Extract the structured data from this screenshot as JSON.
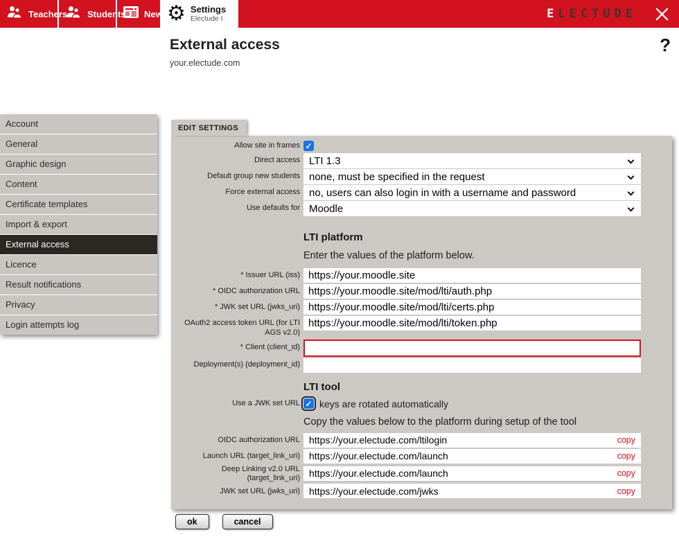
{
  "topbar": {
    "tabs": [
      {
        "label": "Teachers"
      },
      {
        "label": "Students"
      },
      {
        "label": "News"
      },
      {
        "label": "Settings",
        "sublabel": "Electude I"
      }
    ],
    "brand_first_letter": "E",
    "brand_rest": "LECTUDE"
  },
  "header": {
    "title": "External access",
    "subtitle": "your.electude.com",
    "help_label": "?"
  },
  "sidebar": {
    "items": [
      {
        "label": "Account"
      },
      {
        "label": "General"
      },
      {
        "label": "Graphic design"
      },
      {
        "label": "Content"
      },
      {
        "label": "Certificate templates"
      },
      {
        "label": "Import & export"
      },
      {
        "label": "External access",
        "selected": true
      },
      {
        "label": "Licence"
      },
      {
        "label": "Result notifications"
      },
      {
        "label": "Privacy"
      },
      {
        "label": "Login attempts log"
      }
    ]
  },
  "panel": {
    "tab_label": "EDIT SETTINGS",
    "fields": {
      "allow_frames": {
        "label": "Allow site in frames",
        "checked": true
      },
      "direct_access": {
        "label": "Direct access",
        "value": "LTI 1.3"
      },
      "default_group": {
        "label": "Default group new students",
        "value": "none, must be specified in the request"
      },
      "force_external": {
        "label": "Force external access",
        "value": "no, users can also login in with a username and password"
      },
      "use_defaults": {
        "label": "Use defaults for",
        "value": "Moodle"
      }
    },
    "lti_platform": {
      "heading": "LTI platform",
      "intro": "Enter the values of the platform below.",
      "issuer": {
        "label": "* Issuer URL (iss)",
        "value": "https://your.moodle.site"
      },
      "oidc_auth": {
        "label": "* OIDC authorization URL",
        "value": "https://your.moodle.site/mod/lti/auth.php"
      },
      "jwk_set": {
        "label": "* JWK set URL (jwks_uri)",
        "value": "https://your.moodle.site/mod/lti/certs.php"
      },
      "oauth2_token": {
        "label": "OAuth2 access token URL (for LTI AGS v2.0)",
        "value": "https://your.moodle.site/mod/lti/token.php"
      },
      "client": {
        "label": "* Client (client_id)",
        "value": ""
      },
      "deployment": {
        "label": "Deployment(s) (deployment_id)",
        "value": ""
      }
    },
    "lti_tool": {
      "heading": "LTI tool",
      "jwk_checkbox": {
        "label": "Use a JWK set URL",
        "note": "keys are rotated automatically",
        "checked": true
      },
      "copy_intro": "Copy the values below to the platform during setup of the tool",
      "copy_rows": [
        {
          "label": "OIDC authorization URL",
          "value": "https://your.electude.com/ltilogin",
          "action": "copy"
        },
        {
          "label": "Launch URL (target_link_uri)",
          "value": "https://your.electude.com/launch",
          "action": "copy"
        },
        {
          "label": "Deep Linking v2.0 URL (target_link_uri)",
          "value": "https://your.electude.com/launch",
          "action": "copy"
        },
        {
          "label": "JWK set URL (jwks_uri)",
          "value": "https://your.electude.com/jwks",
          "action": "copy"
        }
      ]
    }
  },
  "footer": {
    "ok_label": "ok",
    "cancel_label": "cancel"
  },
  "colors": {
    "brand_red": "#d2121e",
    "panel_bg": "#ccc9c4",
    "sidebar_selected_bg": "#2b2823",
    "checkbox_blue": "#1a73e8",
    "copy_red": "#d2121e"
  }
}
